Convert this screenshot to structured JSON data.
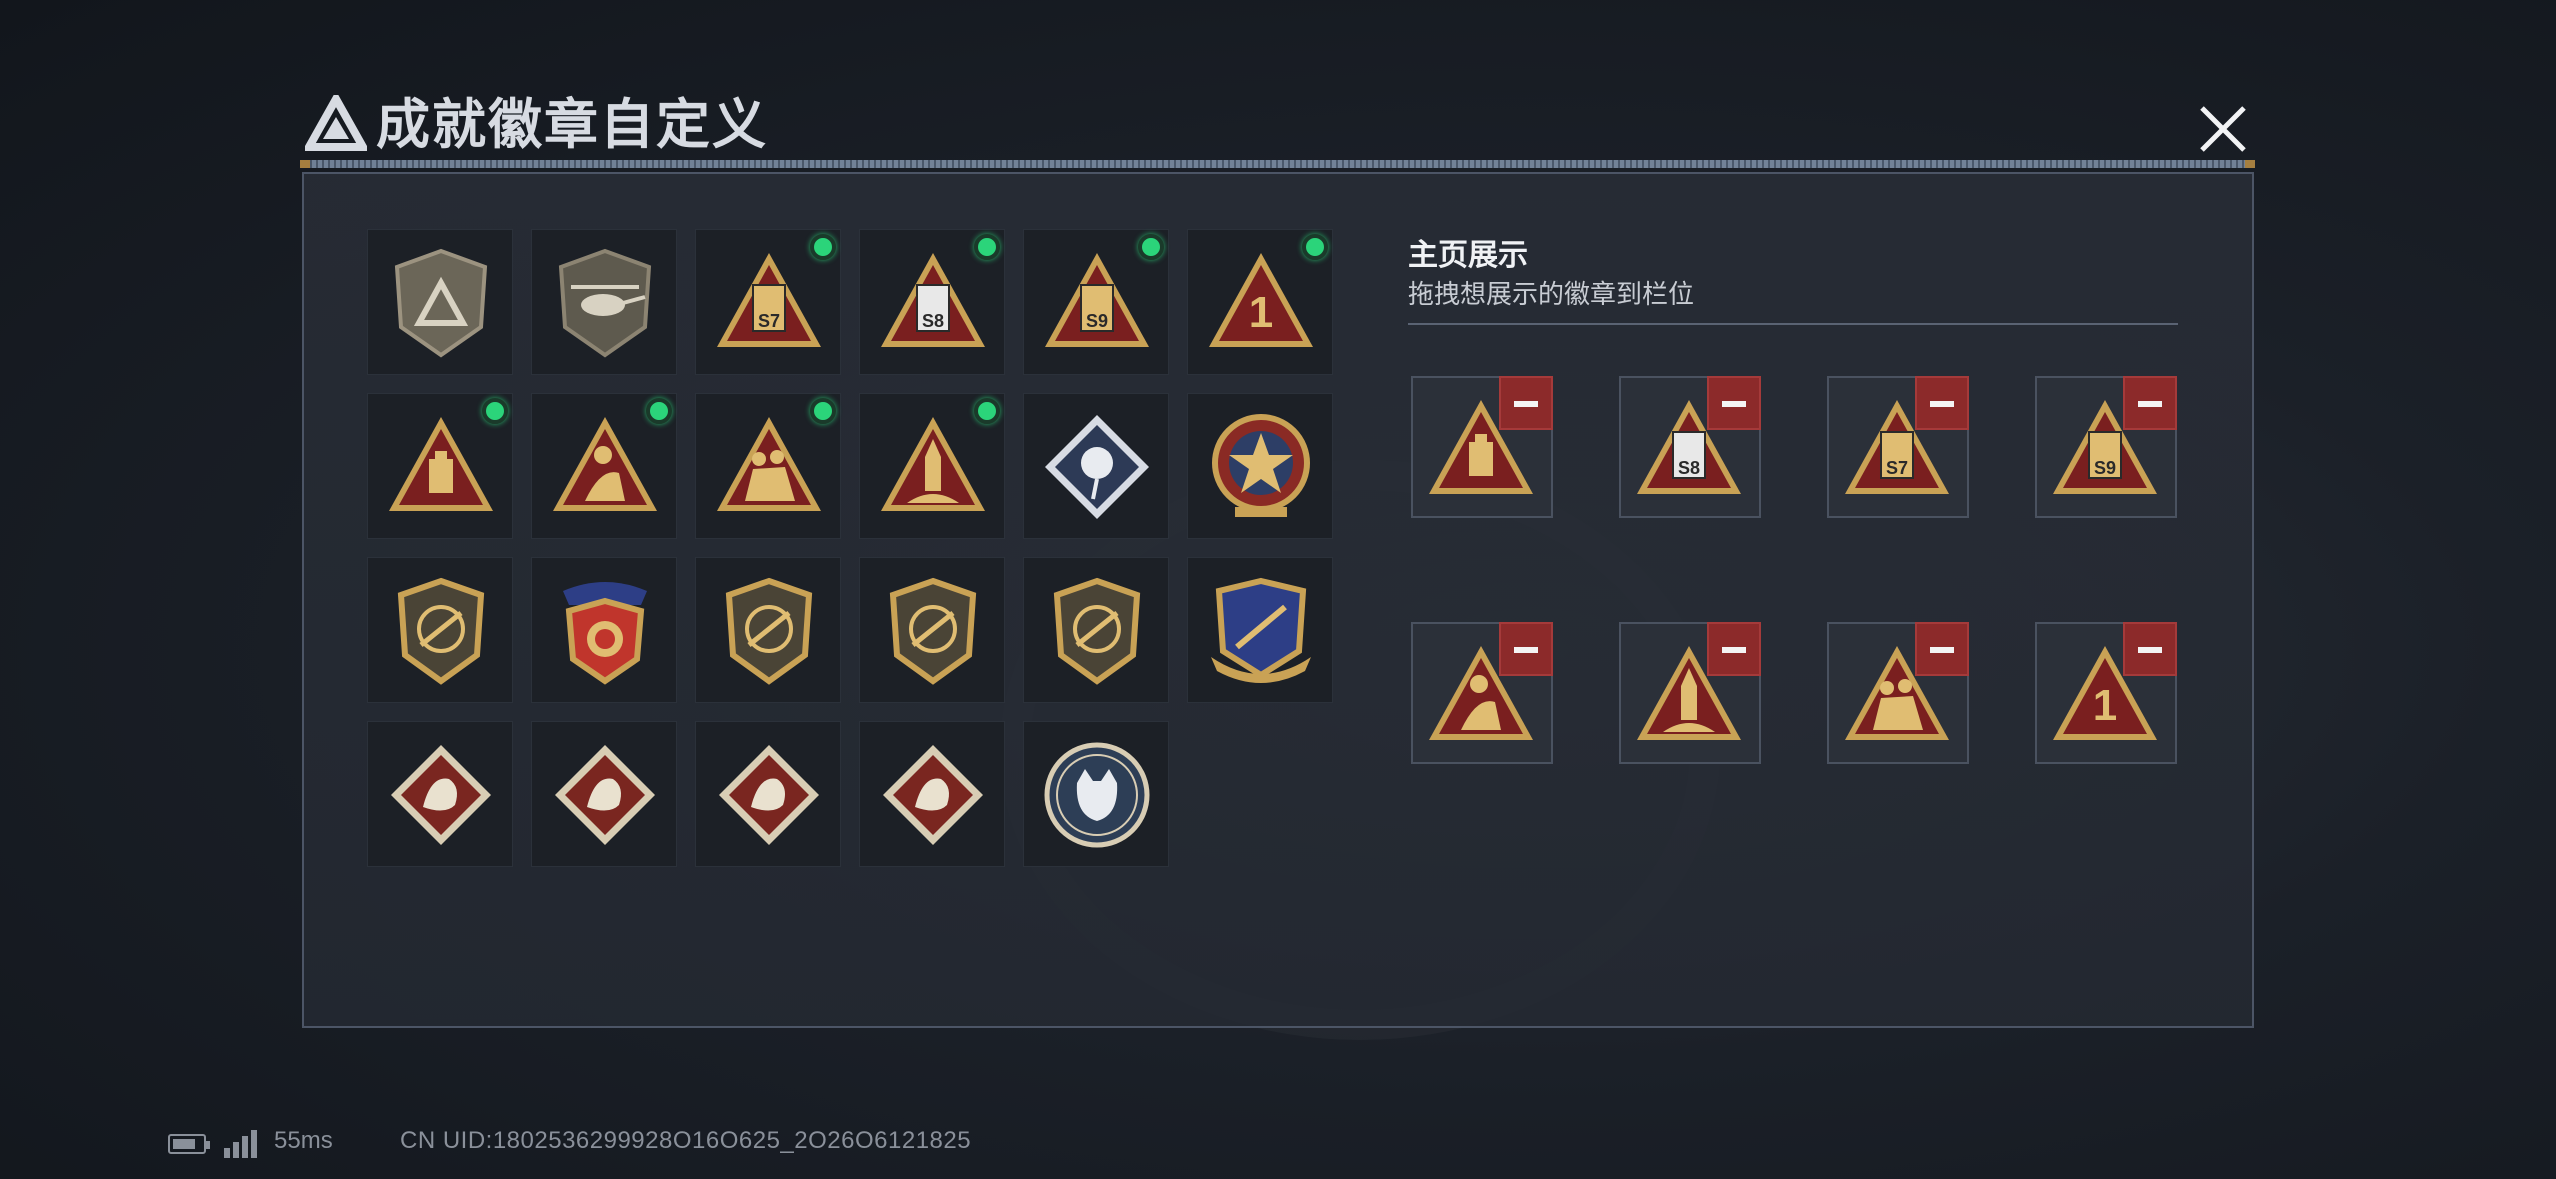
{
  "window": {
    "title": "成就徽章自定义",
    "close_icon": "close-icon",
    "logo_icon": "delta-logo-icon"
  },
  "badges": [
    {
      "name": "shield-delta-badge",
      "new": false
    },
    {
      "name": "helicopter-shield-badge",
      "new": false
    },
    {
      "name": "s7-triangle-badge",
      "new": true,
      "label": "S7"
    },
    {
      "name": "s8-triangle-badge",
      "new": true,
      "label": "S8"
    },
    {
      "name": "s9-triangle-badge",
      "new": true,
      "label": "S9"
    },
    {
      "name": "rank-1-triangle-badge",
      "new": true,
      "label": "1"
    },
    {
      "name": "drive-triangle-badge",
      "new": true
    },
    {
      "name": "soldier-triangle-badge",
      "new": true
    },
    {
      "name": "squad-triangle-badge",
      "new": true
    },
    {
      "name": "rocket-triangle-badge",
      "new": true
    },
    {
      "name": "rose-diamond-badge",
      "new": false
    },
    {
      "name": "star-medal-badge",
      "new": false
    },
    {
      "name": "wing-shield-badge",
      "new": false
    },
    {
      "name": "stars-shield-badge",
      "new": false
    },
    {
      "name": "gem-shield-badge",
      "new": false
    },
    {
      "name": "rifle-shield-badge",
      "new": false
    },
    {
      "name": "pistol-shield-badge",
      "new": false
    },
    {
      "name": "crest-badge",
      "new": false
    },
    {
      "name": "wolf-diamond-badge",
      "new": false
    },
    {
      "name": "dragon-diamond-badge",
      "new": false
    },
    {
      "name": "dragon-diamond-badge-2",
      "new": false
    },
    {
      "name": "runner-diamond-badge",
      "new": false
    },
    {
      "name": "wildcat-round-badge",
      "new": false
    }
  ],
  "display": {
    "title": "主页展示",
    "subtitle": "拖拽想展示的徽章到栏位",
    "slots": [
      {
        "badge": "drive-triangle-badge"
      },
      {
        "badge": "s8-triangle-badge",
        "label": "S8"
      },
      {
        "badge": "s7-triangle-badge",
        "label": "S7"
      },
      {
        "badge": "s9-triangle-badge",
        "label": "S9"
      },
      {
        "badge": "soldier-triangle-badge"
      },
      {
        "badge": "rocket-triangle-badge"
      },
      {
        "badge": "squad-triangle-badge"
      },
      {
        "badge": "rank-1-triangle-badge",
        "label": "1"
      }
    ]
  },
  "status": {
    "battery_icon": "battery-icon",
    "signal_icon": "signal-icon",
    "ping": "55ms",
    "uid": "CN UID:1802536299928O16O625_2O26O6121825"
  }
}
